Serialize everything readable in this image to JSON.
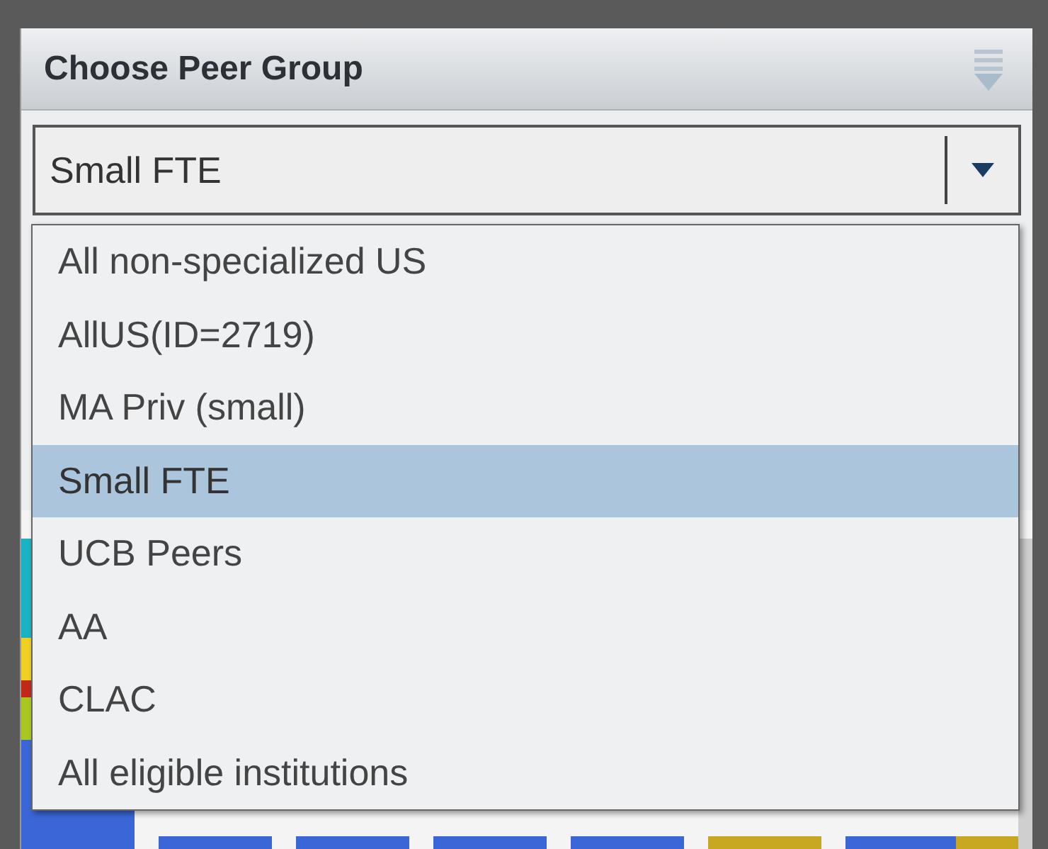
{
  "panel": {
    "title": "Choose Peer Group"
  },
  "combo": {
    "value": "Small FTE"
  },
  "options": [
    {
      "label": "All non-specialized US",
      "selected": false
    },
    {
      "label": "AllUS(ID=2719)",
      "selected": false
    },
    {
      "label": "MA Priv (small)",
      "selected": false
    },
    {
      "label": "Small FTE",
      "selected": true
    },
    {
      "label": "UCB Peers",
      "selected": false
    },
    {
      "label": "AA",
      "selected": false
    },
    {
      "label": "CLAC",
      "selected": false
    },
    {
      "label": "All eligible institutions",
      "selected": false
    }
  ]
}
